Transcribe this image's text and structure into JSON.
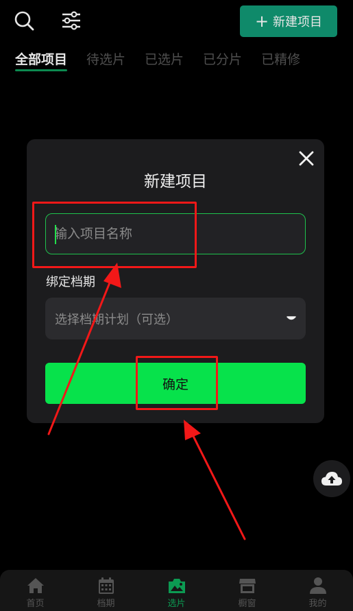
{
  "header": {
    "search_icon": "search-icon",
    "filter_icon": "sliders-icon",
    "new_project_label": "新建项目"
  },
  "tabs": [
    {
      "label": "全部项目",
      "active": true
    },
    {
      "label": "待选片",
      "active": false
    },
    {
      "label": "已选片",
      "active": false
    },
    {
      "label": "已分片",
      "active": false
    },
    {
      "label": "已精修",
      "active": false
    }
  ],
  "modal": {
    "title": "新建项目",
    "name_placeholder": "输入项目名称",
    "bind_label": "绑定档期",
    "schedule_placeholder": "选择档期计划（可选）",
    "confirm_label": "确定"
  },
  "bottom_nav": [
    {
      "label": "首页",
      "icon": "home-icon",
      "active": false
    },
    {
      "label": "档期",
      "icon": "calendar-icon",
      "active": false
    },
    {
      "label": "选片",
      "icon": "photo-icon",
      "active": true
    },
    {
      "label": "橱窗",
      "icon": "storefront-icon",
      "active": false
    },
    {
      "label": "我的",
      "icon": "user-icon",
      "active": false
    }
  ],
  "colors": {
    "accent": "#07e24b",
    "new_button": "#0f8a6a",
    "annotation": "#f21818"
  }
}
